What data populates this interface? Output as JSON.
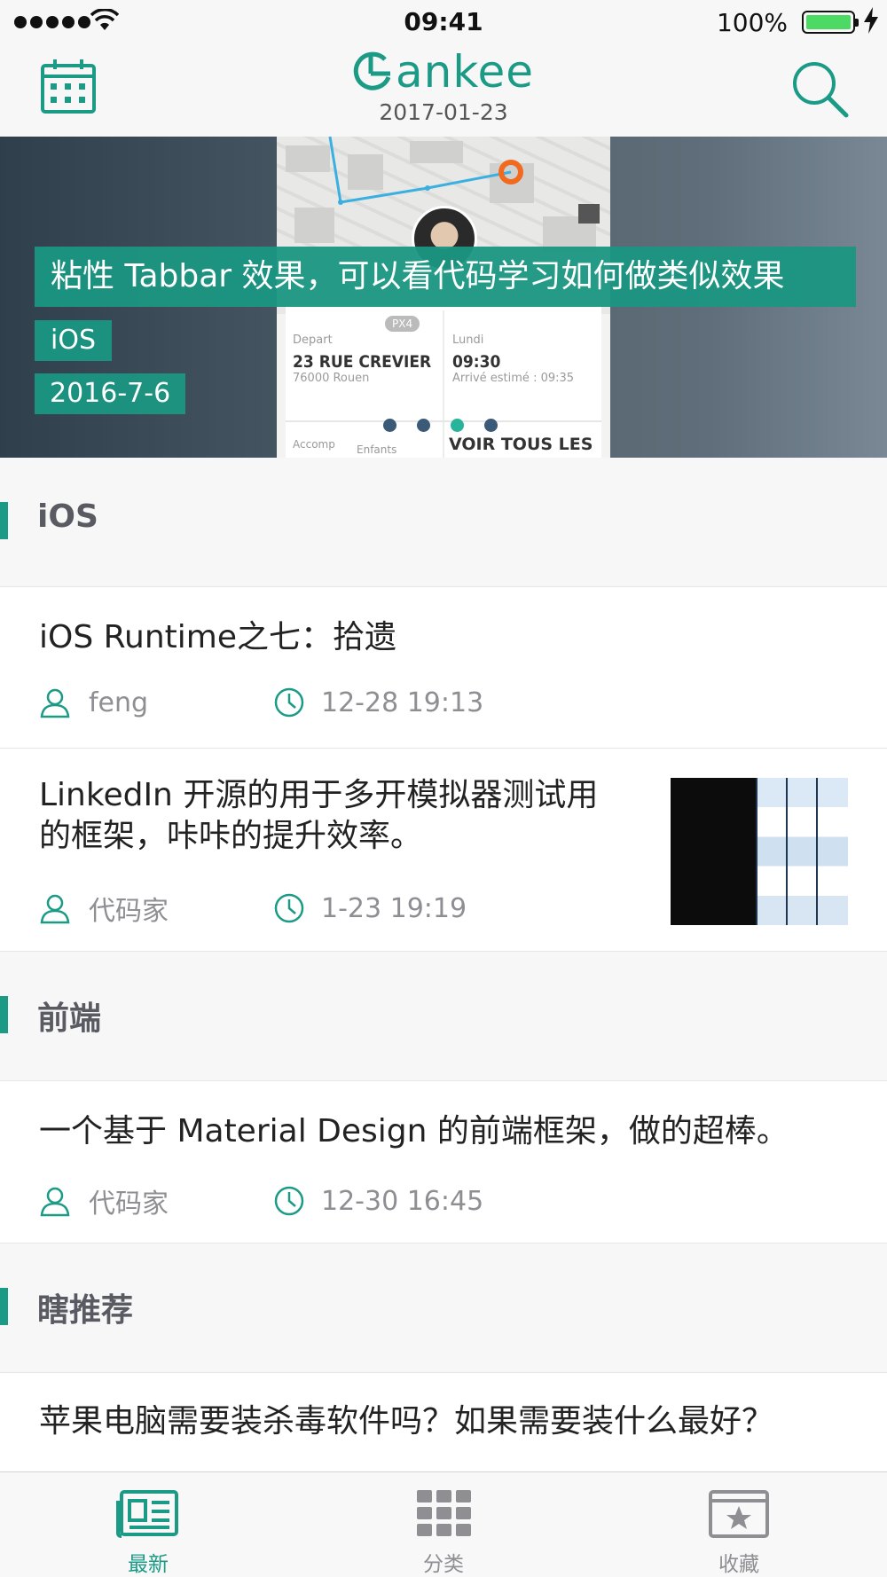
{
  "status_bar": {
    "time": "09:41",
    "battery": "100%"
  },
  "nav": {
    "logo": "ankee",
    "date": "2017-01-23"
  },
  "banner": {
    "title": "粘性 Tabbar 效果，可以看代码学习如何做类似效果",
    "tag": "iOS",
    "date": "2016-7-6",
    "pages": 4,
    "active_page": 3,
    "screenshot": {
      "plate": "PX4",
      "depart_label": "Depart",
      "depart_address": "23 RUE CREVIER",
      "depart_city": "76000 Rouen",
      "day_label": "Lundi",
      "arrival_time": "09:30",
      "arrival_note": "Arrivé estimé : 09:35",
      "accomp": "Accomp",
      "enfants": "Enfants",
      "voir": "VOIR TOUS LES"
    }
  },
  "sections": [
    {
      "label": "iOS",
      "items": [
        {
          "title": "iOS Runtime之七：拾遗",
          "author": "feng",
          "time": "12-28  19:13"
        },
        {
          "title_line1": "LinkedIn 开源的用于多开模拟器测试用",
          "title_line2": "的框架，咔咔的提升效率。",
          "author": "代码家",
          "time": "1-23  19:19"
        }
      ]
    },
    {
      "label": "前端",
      "items": [
        {
          "title": "一个基于 Material Design 的前端框架，做的超棒。",
          "author": "代码家",
          "time": "12-30  16:45"
        }
      ]
    },
    {
      "label": "瞎推荐",
      "items": [
        {
          "title": "苹果电脑需要装杀毒软件吗？如果需要装什么最好？"
        }
      ]
    }
  ],
  "tabs": [
    {
      "label": "最新",
      "icon": "newspaper-icon",
      "active": true
    },
    {
      "label": "分类",
      "icon": "grid-icon",
      "active": false
    },
    {
      "label": "收藏",
      "icon": "star-box-icon",
      "active": false
    }
  ],
  "colors": {
    "accent": "#1b9a86",
    "pager_inactive": "#3a5a78",
    "pager_active": "#28b39b"
  }
}
